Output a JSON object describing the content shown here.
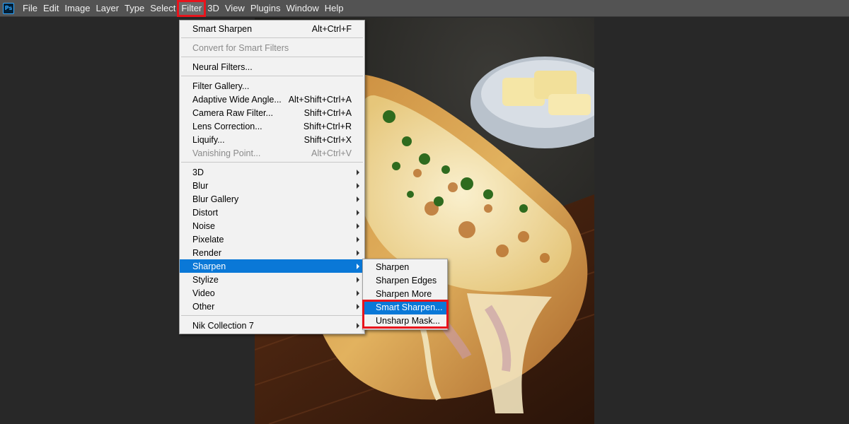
{
  "app": {
    "logo_text": "Ps"
  },
  "menubar": {
    "items": [
      "File",
      "Edit",
      "Image",
      "Layer",
      "Type",
      "Select",
      "Filter",
      "3D",
      "View",
      "Plugins",
      "Window",
      "Help"
    ],
    "active": "Filter"
  },
  "filter_menu": {
    "groups": [
      [
        {
          "label": "Smart Sharpen",
          "shortcut": "Alt+Ctrl+F"
        }
      ],
      [
        {
          "label": "Convert for Smart Filters",
          "disabled": true
        }
      ],
      [
        {
          "label": "Neural Filters..."
        }
      ],
      [
        {
          "label": "Filter Gallery..."
        },
        {
          "label": "Adaptive Wide Angle...",
          "shortcut": "Alt+Shift+Ctrl+A"
        },
        {
          "label": "Camera Raw Filter...",
          "shortcut": "Shift+Ctrl+A"
        },
        {
          "label": "Lens Correction...",
          "shortcut": "Shift+Ctrl+R"
        },
        {
          "label": "Liquify...",
          "shortcut": "Shift+Ctrl+X"
        },
        {
          "label": "Vanishing Point...",
          "shortcut": "Alt+Ctrl+V",
          "disabled": true
        }
      ],
      [
        {
          "label": "3D",
          "submenu": true
        },
        {
          "label": "Blur",
          "submenu": true
        },
        {
          "label": "Blur Gallery",
          "submenu": true
        },
        {
          "label": "Distort",
          "submenu": true
        },
        {
          "label": "Noise",
          "submenu": true
        },
        {
          "label": "Pixelate",
          "submenu": true
        },
        {
          "label": "Render",
          "submenu": true
        },
        {
          "label": "Sharpen",
          "submenu": true,
          "selected": true
        },
        {
          "label": "Stylize",
          "submenu": true
        },
        {
          "label": "Video",
          "submenu": true
        },
        {
          "label": "Other",
          "submenu": true
        }
      ],
      [
        {
          "label": "Nik Collection 7",
          "submenu": true
        }
      ]
    ]
  },
  "sharpen_submenu": {
    "items": [
      {
        "label": "Sharpen"
      },
      {
        "label": "Sharpen Edges"
      },
      {
        "label": "Sharpen More"
      },
      {
        "label": "Smart Sharpen...",
        "selected": true
      },
      {
        "label": "Unsharp Mask..."
      }
    ]
  },
  "colors": {
    "highlight_red": "#e8141c",
    "selection_blue": "#0a78d7",
    "menubar_bg": "#535353",
    "workspace_bg": "#282828"
  }
}
